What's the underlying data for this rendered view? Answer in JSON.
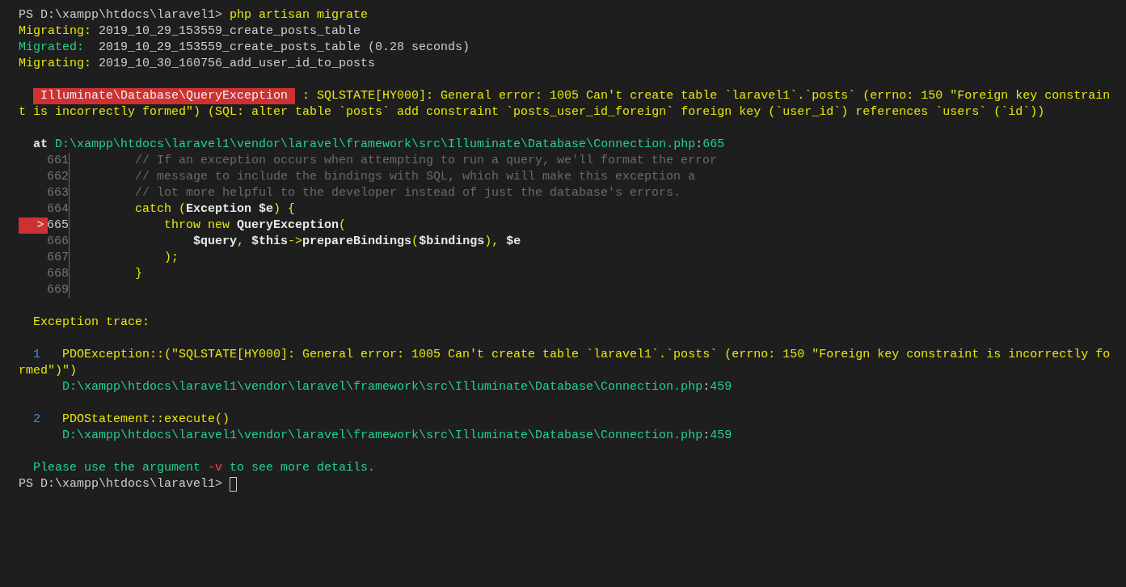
{
  "terminal": {
    "current_marker": ">",
    "lines": [
      {
        "kind": "text",
        "segments": [
          {
            "kind": "plain",
            "text": "PS D:\\xampp\\htdocs\\laravel1> "
          },
          {
            "kind": "yellow",
            "text": "php artisan migrate"
          }
        ]
      },
      {
        "kind": "text",
        "segments": [
          {
            "kind": "yellow",
            "text": "Migrating:"
          },
          {
            "kind": "plain",
            "text": " 2019_10_29_153559_create_posts_table"
          }
        ]
      },
      {
        "kind": "text",
        "segments": [
          {
            "kind": "green",
            "text": "Migrated:"
          },
          {
            "kind": "plain",
            "text": "  2019_10_29_153559_create_posts_table (0.28 seconds)"
          }
        ]
      },
      {
        "kind": "text",
        "segments": [
          {
            "kind": "yellow",
            "text": "Migrating:"
          },
          {
            "kind": "plain",
            "text": " 2019_10_30_160756_add_user_id_to_posts"
          }
        ]
      },
      {
        "kind": "blank"
      },
      {
        "kind": "error",
        "badge": "Illuminate\\Database\\QueryException",
        "segments": [
          {
            "kind": "yellow",
            "text": ": SQLSTATE[HY000]: General error: 1005 Can't create table `laravel1`.`posts` (errno: 150 \"Foreign key constrain"
          }
        ]
      },
      {
        "kind": "text",
        "segments": [
          {
            "kind": "yellow",
            "text": "t is incorrectly formed\") (SQL: alter table `posts` add constraint `posts_user_id_foreign` foreign key (`user_id`) references `users` (`id`))"
          }
        ]
      },
      {
        "kind": "blank"
      },
      {
        "kind": "block",
        "segments": [
          {
            "kind": "bold",
            "text": "at"
          },
          {
            "kind": "green",
            "text": " D:\\xampp\\htdocs\\laravel1\\vendor\\laravel\\framework\\src\\Illuminate\\Database\\Connection.php"
          },
          {
            "kind": "plain",
            "text": ":"
          },
          {
            "kind": "green",
            "text": "665"
          }
        ]
      },
      {
        "kind": "code",
        "number": "661",
        "current": false,
        "segments": [
          {
            "kind": "dim",
            "text": "         // If an exception occurs when attempting to run a query, we'll format the error"
          }
        ]
      },
      {
        "kind": "code",
        "number": "662",
        "current": false,
        "segments": [
          {
            "kind": "dim",
            "text": "         // message to include the bindings with SQL, which will make this exception a"
          }
        ]
      },
      {
        "kind": "code",
        "number": "663",
        "current": false,
        "segments": [
          {
            "kind": "dim",
            "text": "         // lot more helpful to the developer instead of just the database's errors."
          }
        ]
      },
      {
        "kind": "code",
        "number": "664",
        "current": false,
        "segments": [
          {
            "kind": "yellow",
            "text": "         catch ("
          },
          {
            "kind": "bold",
            "text": "Exception $e"
          },
          {
            "kind": "yellow",
            "text": ") {"
          }
        ]
      },
      {
        "kind": "code",
        "number": "665",
        "current": true,
        "segments": [
          {
            "kind": "yellow",
            "text": "             throw new "
          },
          {
            "kind": "bold",
            "text": "QueryException"
          },
          {
            "kind": "yellow",
            "text": "("
          }
        ]
      },
      {
        "kind": "code",
        "number": "666",
        "current": false,
        "segments": [
          {
            "kind": "bold",
            "text": "                 $query"
          },
          {
            "kind": "yellow",
            "text": ", "
          },
          {
            "kind": "bold",
            "text": "$this"
          },
          {
            "kind": "yellow",
            "text": "->"
          },
          {
            "kind": "bold",
            "text": "prepareBindings"
          },
          {
            "kind": "yellow",
            "text": "("
          },
          {
            "kind": "bold",
            "text": "$bindings"
          },
          {
            "kind": "yellow",
            "text": "), "
          },
          {
            "kind": "bold",
            "text": "$e"
          }
        ]
      },
      {
        "kind": "code",
        "number": "667",
        "current": false,
        "segments": [
          {
            "kind": "yellow",
            "text": "             );"
          }
        ]
      },
      {
        "kind": "code",
        "number": "668",
        "current": false,
        "segments": [
          {
            "kind": "yellow",
            "text": "         }"
          }
        ]
      },
      {
        "kind": "code",
        "number": "669",
        "current": false
      },
      {
        "kind": "blank"
      },
      {
        "kind": "block",
        "segments": [
          {
            "kind": "yellow",
            "text": "Exception trace:"
          }
        ]
      },
      {
        "kind": "blank"
      },
      {
        "kind": "trace",
        "number": "1",
        "segments": [
          {
            "kind": "yellow",
            "text": "PDOException::(\"SQLSTATE[HY000]: General error: 1005 Can't create table `laravel1`.`posts` (errno: 150 \"Foreign key constraint is incorrectly fo"
          }
        ]
      },
      {
        "kind": "text",
        "segments": [
          {
            "kind": "yellow",
            "text": "rmed\")\")"
          }
        ]
      },
      {
        "kind": "trace-cont",
        "segments": [
          {
            "kind": "green",
            "text": "D:\\xampp\\htdocs\\laravel1\\vendor\\laravel\\framework\\src\\Illuminate\\Database\\Connection.php"
          },
          {
            "kind": "plain",
            "text": ":"
          },
          {
            "kind": "green",
            "text": "459"
          }
        ]
      },
      {
        "kind": "blank"
      },
      {
        "kind": "trace",
        "number": "2",
        "segments": [
          {
            "kind": "yellow",
            "text": "PDOStatement::execute()"
          }
        ]
      },
      {
        "kind": "trace-cont",
        "segments": [
          {
            "kind": "green",
            "text": "D:\\xampp\\htdocs\\laravel1\\vendor\\laravel\\framework\\src\\Illuminate\\Database\\Connection.php"
          },
          {
            "kind": "plain",
            "text": ":"
          },
          {
            "kind": "green",
            "text": "459"
          }
        ]
      },
      {
        "kind": "blank"
      },
      {
        "kind": "block",
        "segments": [
          {
            "kind": "green",
            "text": "Please use the argument "
          },
          {
            "kind": "red",
            "text": "-v"
          },
          {
            "kind": "green",
            "text": " to see more details."
          }
        ]
      },
      {
        "kind": "prompt",
        "segments": [
          {
            "kind": "plain",
            "text": "PS D:\\xampp\\htdocs\\laravel1> "
          }
        ]
      }
    ]
  }
}
